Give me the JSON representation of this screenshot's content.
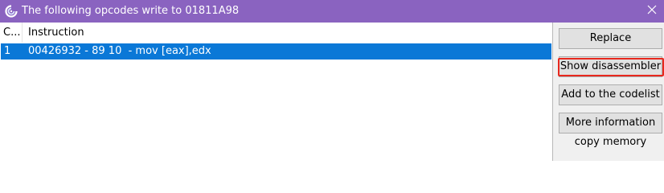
{
  "window": {
    "title": "The following opcodes write to 01811A98",
    "close_symbol": "×",
    "title_bar_color": "#8a63c0"
  },
  "list": {
    "columns": [
      "C...",
      "Instruction"
    ],
    "rows": [
      {
        "count": "1",
        "instruction": "00426932 - 89 10  - mov [eax],edx"
      }
    ],
    "selected_color": "#0a78d7"
  },
  "buttons": {
    "replace": "Replace",
    "show_disassembler": "Show disassembler",
    "add_to_codelist": "Add to the codelist",
    "more_information": "More information"
  },
  "copy_memory": "copy memory",
  "annotation_color": "#e8281e",
  "icons": {
    "app": "cheat-engine-icon",
    "close": "close-icon"
  }
}
